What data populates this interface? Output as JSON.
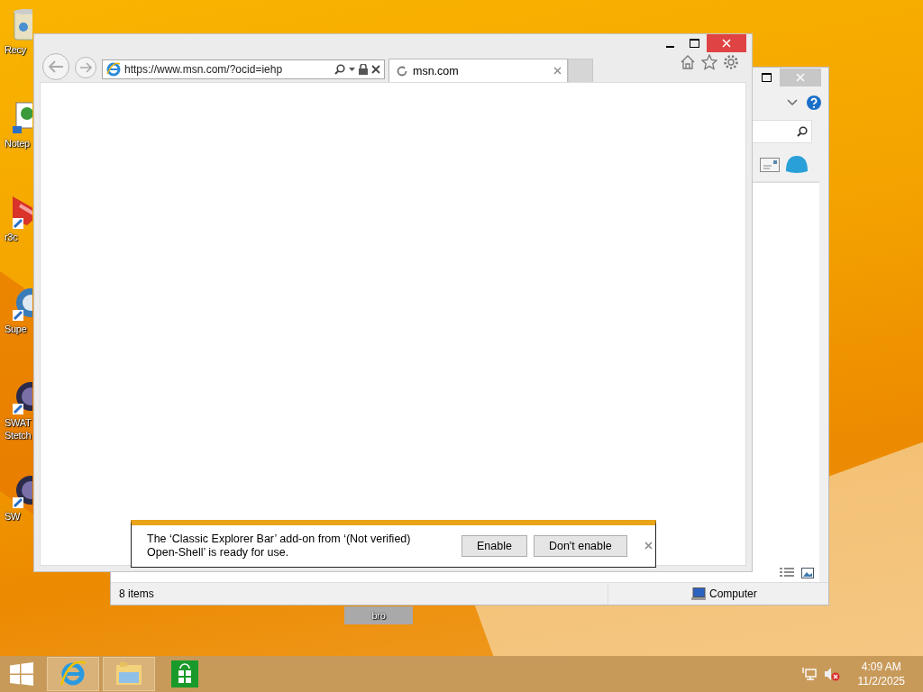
{
  "desktop_icons": [
    {
      "label": "Recy",
      "kind": "bin",
      "selected": false
    },
    {
      "label": "Notep",
      "kind": "note",
      "selected": false
    },
    {
      "label": "r3c",
      "kind": "red",
      "selected": false
    },
    {
      "label": "Supe",
      "kind": "globe",
      "selected": false
    },
    {
      "label": "SWAT Stetch",
      "kind": "game",
      "selected": false
    },
    {
      "label": "SW",
      "kind": "game",
      "selected": false
    },
    {
      "label": "bro",
      "kind": "none",
      "selected": true
    }
  ],
  "explorer_window": {
    "status_text": "8 items",
    "location": "Computer"
  },
  "browser_window": {
    "address": "https://www.msn.com/?ocid=iehp",
    "tabs": [
      {
        "title": "msn.com",
        "selected": true
      }
    ],
    "notification": {
      "message": "The ‘Classic Explorer Bar’ add-on from ‘(Not verified) Open-Shell’ is ready for use.",
      "buttons": [
        "Enable",
        "Don't enable"
      ]
    }
  },
  "taskbar": {
    "buttons": [
      {
        "kind": "ie",
        "running": true
      },
      {
        "kind": "folder",
        "running": true
      },
      {
        "kind": "store",
        "running": false
      }
    ],
    "time": "4:09 AM",
    "date": "11/2/2025"
  }
}
